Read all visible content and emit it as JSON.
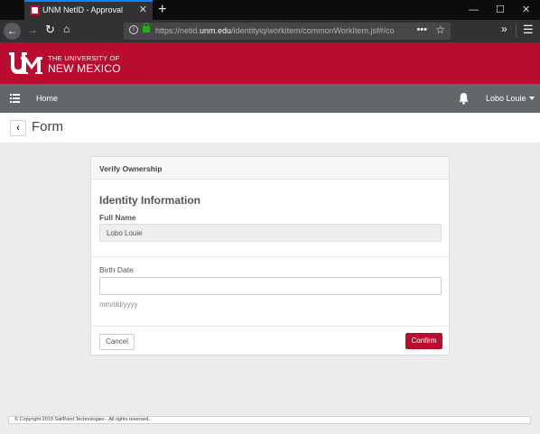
{
  "browser": {
    "tab_title": "UNM NetID - Approval",
    "tab_close": "✕",
    "new_tab": "+",
    "window_minimize": "—",
    "window_maximize": "☐",
    "window_close": "✕",
    "url_prefix": "https://netid.",
    "url_host": "unm.edu",
    "url_path": "/identityiq/workitem/commonWorkItem.jsf#/co",
    "url_more": "•••",
    "bookmark_icon": "star-icon",
    "overflow": "»",
    "menu": "☰"
  },
  "brand": {
    "line1": "THE UNIVERSITY OF",
    "line2": "NEW MEXICO",
    "color": "#ba0c2f"
  },
  "app_nav": {
    "home_label": "Home",
    "user_name": "Lobo Louie"
  },
  "page": {
    "back_glyph": "‹",
    "title": "Form"
  },
  "form": {
    "header_title": "Verify Ownership",
    "section_title": "Identity Information",
    "full_name_label": "Full Name",
    "full_name_value": "Lobo Louie",
    "birth_date_label": "Birth Date",
    "birth_date_value": "",
    "birth_date_help": "mm/dd/yyyy",
    "cancel_label": "Cancel",
    "confirm_label": "Confirm"
  },
  "footer": {
    "copyright": "© Copyright 2019 SailPoint Technologies - All rights reserved."
  }
}
